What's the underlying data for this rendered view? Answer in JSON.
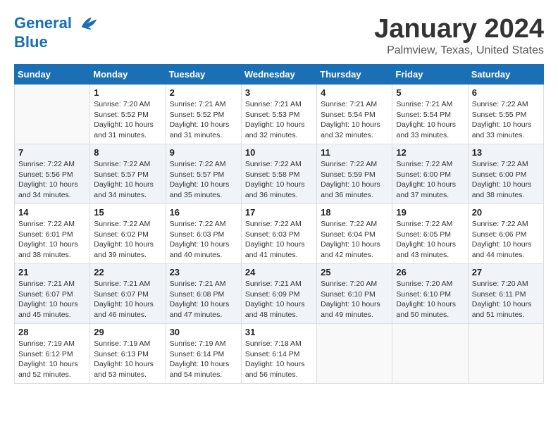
{
  "header": {
    "logo_line1": "General",
    "logo_line2": "Blue",
    "title": "January 2024",
    "location": "Palmview, Texas, United States"
  },
  "days_of_week": [
    "Sunday",
    "Monday",
    "Tuesday",
    "Wednesday",
    "Thursday",
    "Friday",
    "Saturday"
  ],
  "weeks": [
    [
      {
        "day": "",
        "sunrise": "",
        "sunset": "",
        "daylight": ""
      },
      {
        "day": "1",
        "sunrise": "7:20 AM",
        "sunset": "5:52 PM",
        "daylight": "10 hours and 31 minutes."
      },
      {
        "day": "2",
        "sunrise": "7:21 AM",
        "sunset": "5:52 PM",
        "daylight": "10 hours and 31 minutes."
      },
      {
        "day": "3",
        "sunrise": "7:21 AM",
        "sunset": "5:53 PM",
        "daylight": "10 hours and 32 minutes."
      },
      {
        "day": "4",
        "sunrise": "7:21 AM",
        "sunset": "5:54 PM",
        "daylight": "10 hours and 32 minutes."
      },
      {
        "day": "5",
        "sunrise": "7:21 AM",
        "sunset": "5:54 PM",
        "daylight": "10 hours and 33 minutes."
      },
      {
        "day": "6",
        "sunrise": "7:22 AM",
        "sunset": "5:55 PM",
        "daylight": "10 hours and 33 minutes."
      }
    ],
    [
      {
        "day": "7",
        "sunrise": "7:22 AM",
        "sunset": "5:56 PM",
        "daylight": "10 hours and 34 minutes."
      },
      {
        "day": "8",
        "sunrise": "7:22 AM",
        "sunset": "5:57 PM",
        "daylight": "10 hours and 34 minutes."
      },
      {
        "day": "9",
        "sunrise": "7:22 AM",
        "sunset": "5:57 PM",
        "daylight": "10 hours and 35 minutes."
      },
      {
        "day": "10",
        "sunrise": "7:22 AM",
        "sunset": "5:58 PM",
        "daylight": "10 hours and 36 minutes."
      },
      {
        "day": "11",
        "sunrise": "7:22 AM",
        "sunset": "5:59 PM",
        "daylight": "10 hours and 36 minutes."
      },
      {
        "day": "12",
        "sunrise": "7:22 AM",
        "sunset": "6:00 PM",
        "daylight": "10 hours and 37 minutes."
      },
      {
        "day": "13",
        "sunrise": "7:22 AM",
        "sunset": "6:00 PM",
        "daylight": "10 hours and 38 minutes."
      }
    ],
    [
      {
        "day": "14",
        "sunrise": "7:22 AM",
        "sunset": "6:01 PM",
        "daylight": "10 hours and 38 minutes."
      },
      {
        "day": "15",
        "sunrise": "7:22 AM",
        "sunset": "6:02 PM",
        "daylight": "10 hours and 39 minutes."
      },
      {
        "day": "16",
        "sunrise": "7:22 AM",
        "sunset": "6:03 PM",
        "daylight": "10 hours and 40 minutes."
      },
      {
        "day": "17",
        "sunrise": "7:22 AM",
        "sunset": "6:03 PM",
        "daylight": "10 hours and 41 minutes."
      },
      {
        "day": "18",
        "sunrise": "7:22 AM",
        "sunset": "6:04 PM",
        "daylight": "10 hours and 42 minutes."
      },
      {
        "day": "19",
        "sunrise": "7:22 AM",
        "sunset": "6:05 PM",
        "daylight": "10 hours and 43 minutes."
      },
      {
        "day": "20",
        "sunrise": "7:22 AM",
        "sunset": "6:06 PM",
        "daylight": "10 hours and 44 minutes."
      }
    ],
    [
      {
        "day": "21",
        "sunrise": "7:21 AM",
        "sunset": "6:07 PM",
        "daylight": "10 hours and 45 minutes."
      },
      {
        "day": "22",
        "sunrise": "7:21 AM",
        "sunset": "6:07 PM",
        "daylight": "10 hours and 46 minutes."
      },
      {
        "day": "23",
        "sunrise": "7:21 AM",
        "sunset": "6:08 PM",
        "daylight": "10 hours and 47 minutes."
      },
      {
        "day": "24",
        "sunrise": "7:21 AM",
        "sunset": "6:09 PM",
        "daylight": "10 hours and 48 minutes."
      },
      {
        "day": "25",
        "sunrise": "7:20 AM",
        "sunset": "6:10 PM",
        "daylight": "10 hours and 49 minutes."
      },
      {
        "day": "26",
        "sunrise": "7:20 AM",
        "sunset": "6:10 PM",
        "daylight": "10 hours and 50 minutes."
      },
      {
        "day": "27",
        "sunrise": "7:20 AM",
        "sunset": "6:11 PM",
        "daylight": "10 hours and 51 minutes."
      }
    ],
    [
      {
        "day": "28",
        "sunrise": "7:19 AM",
        "sunset": "6:12 PM",
        "daylight": "10 hours and 52 minutes."
      },
      {
        "day": "29",
        "sunrise": "7:19 AM",
        "sunset": "6:13 PM",
        "daylight": "10 hours and 53 minutes."
      },
      {
        "day": "30",
        "sunrise": "7:19 AM",
        "sunset": "6:14 PM",
        "daylight": "10 hours and 54 minutes."
      },
      {
        "day": "31",
        "sunrise": "7:18 AM",
        "sunset": "6:14 PM",
        "daylight": "10 hours and 56 minutes."
      },
      {
        "day": "",
        "sunrise": "",
        "sunset": "",
        "daylight": ""
      },
      {
        "day": "",
        "sunrise": "",
        "sunset": "",
        "daylight": ""
      },
      {
        "day": "",
        "sunrise": "",
        "sunset": "",
        "daylight": ""
      }
    ]
  ],
  "labels": {
    "sunrise_prefix": "Sunrise: ",
    "sunset_prefix": "Sunset: ",
    "daylight_prefix": "Daylight: "
  }
}
